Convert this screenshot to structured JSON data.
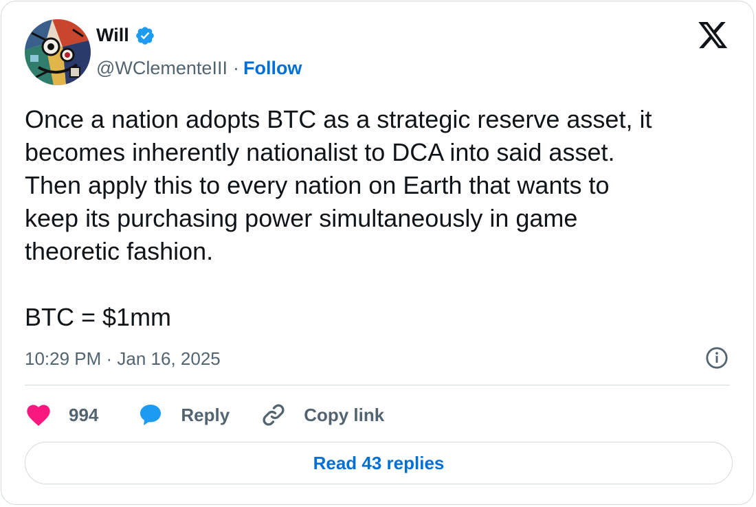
{
  "author": {
    "name": "Will",
    "handle": "@WClementeIII",
    "separator": "·",
    "follow_label": "Follow"
  },
  "tweet": {
    "lines": [
      "Once a nation adopts BTC as a strategic reserve asset, it",
      "becomes inherently nationalist to DCA into said asset.",
      "Then apply this to every nation on Earth that wants to",
      "keep its purchasing power simultaneously in game",
      "theoretic fashion."
    ],
    "closing": "BTC = $1mm",
    "timestamp": "10:29 PM · Jan 16, 2025"
  },
  "actions": {
    "likes_count": "994",
    "reply_label": "Reply",
    "copy_link_label": "Copy link"
  },
  "read_replies_label": "Read 43 replies",
  "colors": {
    "accent": "#006fd6",
    "like": "#f91880",
    "reply_icon": "#1d9bf0",
    "muted": "#536471",
    "verified": "#1d9bf0"
  },
  "icons": {
    "verified": "verified-badge-icon",
    "logo": "x-logo-icon",
    "info": "info-icon",
    "like": "heart-icon",
    "reply": "speech-bubble-icon",
    "link": "link-icon"
  }
}
